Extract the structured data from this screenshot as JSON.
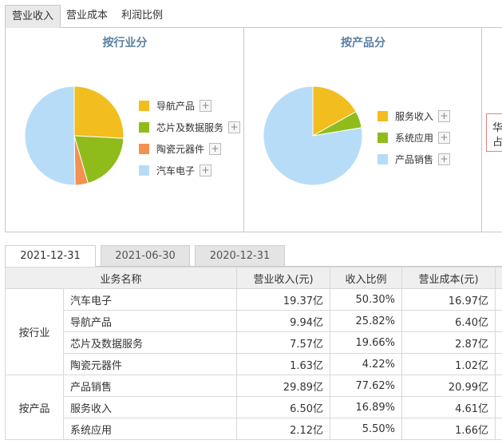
{
  "top_tabs": [
    "营业收入",
    "营业成本",
    "利润比例"
  ],
  "panels": [
    {
      "title": "按行业分",
      "legend": [
        {
          "label": "导航产品",
          "color": "#f2bd1e"
        },
        {
          "label": "芯片及数据服务",
          "color": "#8fbc1b"
        },
        {
          "label": "陶瓷元器件",
          "color": "#f39150"
        },
        {
          "label": "汽车电子",
          "color": "#b7dcf7"
        }
      ]
    },
    {
      "title": "按产品分",
      "legend": [
        {
          "label": "服务收入",
          "color": "#f2bd1e"
        },
        {
          "label": "系统应用",
          "color": "#8fbc1b"
        },
        {
          "label": "产品销售",
          "color": "#b7dcf7"
        }
      ]
    }
  ],
  "tooltip_lines": [
    "华",
    "占"
  ],
  "date_tabs": [
    "2021-12-31",
    "2021-06-30",
    "2020-12-31"
  ],
  "table": {
    "headers": [
      "业务名称",
      "营业收入(元)",
      "收入比例",
      "营业成本(元)"
    ],
    "groups": [
      {
        "name": "按行业",
        "rows": [
          {
            "name": "汽车电子",
            "revenue": "19.37亿",
            "ratio": "50.30%",
            "cost": "16.97亿"
          },
          {
            "name": "导航产品",
            "revenue": "9.94亿",
            "ratio": "25.82%",
            "cost": "6.40亿"
          },
          {
            "name": "芯片及数据服务",
            "revenue": "7.57亿",
            "ratio": "19.66%",
            "cost": "2.87亿"
          },
          {
            "name": "陶瓷元器件",
            "revenue": "1.63亿",
            "ratio": "4.22%",
            "cost": "1.02亿"
          }
        ]
      },
      {
        "name": "按产品",
        "rows": [
          {
            "name": "产品销售",
            "revenue": "29.89亿",
            "ratio": "77.62%",
            "cost": "20.99亿"
          },
          {
            "name": "服务收入",
            "revenue": "6.50亿",
            "ratio": "16.89%",
            "cost": "4.61亿"
          },
          {
            "name": "系统应用",
            "revenue": "2.12亿",
            "ratio": "5.50%",
            "cost": "1.66亿"
          }
        ]
      }
    ]
  },
  "chart_data": [
    {
      "type": "pie",
      "title": "按行业分",
      "categories": [
        "导航产品",
        "芯片及数据服务",
        "陶瓷元器件",
        "汽车电子"
      ],
      "values": [
        25.82,
        19.66,
        4.22,
        50.3
      ],
      "colors": [
        "#f2bd1e",
        "#8fbc1b",
        "#f39150",
        "#b7dcf7"
      ],
      "legend": "right"
    },
    {
      "type": "pie",
      "title": "按产品分",
      "categories": [
        "服务收入",
        "系统应用",
        "产品销售"
      ],
      "values": [
        16.89,
        5.5,
        77.62
      ],
      "colors": [
        "#f2bd1e",
        "#8fbc1b",
        "#b7dcf7"
      ],
      "legend": "right"
    }
  ]
}
